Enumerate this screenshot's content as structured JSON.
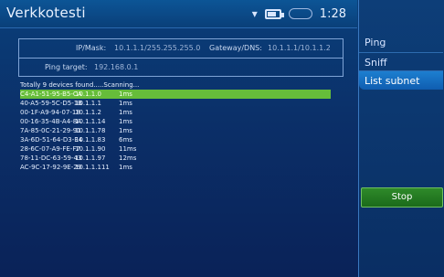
{
  "title": "Verkkotesti",
  "status": {
    "clock": "1:28"
  },
  "sidebar": {
    "tabs": [
      "Ping",
      "Sniff",
      "List subnet"
    ],
    "stop_label": "Stop"
  },
  "config": {
    "ipmask_label": "IP/Mask:",
    "ipmask_value": "10.1.1.1/255.255.255.0",
    "gateway_label": "Gateway/DNS:",
    "gateway_value": "10.1.1.1/10.1.1.2",
    "ping_target_label": "Ping target:",
    "ping_target_value": "192.168.0.1"
  },
  "results": {
    "summary": "Totally 9 devices found.....Scanning...",
    "rows": [
      {
        "mac": "C4-A1-51-95-B5-CA",
        "ip": "10.1.1.0",
        "ms": "1ms",
        "selected": true
      },
      {
        "mac": "40-A5-59-5C-D5-1B",
        "ip": "10.1.1.1",
        "ms": "1ms"
      },
      {
        "mac": "00-1F-A9-94-07-18",
        "ip": "10.1.1.2",
        "ms": "1ms"
      },
      {
        "mac": "00-16-35-4B-A4-8A",
        "ip": "10.1.1.14",
        "ms": "1ms"
      },
      {
        "mac": "7A-85-0C-21-29-91",
        "ip": "10.1.1.78",
        "ms": "1ms"
      },
      {
        "mac": "3A-6D-51-64-D3-E4",
        "ip": "10.1.1.83",
        "ms": "6ms"
      },
      {
        "mac": "28-6C-07-A9-FE-F7",
        "ip": "10.1.1.90",
        "ms": "11ms"
      },
      {
        "mac": "78-11-DC-63-59-43",
        "ip": "10.1.1.97",
        "ms": "12ms"
      },
      {
        "mac": "AC-9C-17-92-9E-29",
        "ip": "10.1.1.111",
        "ms": "1ms"
      }
    ]
  }
}
